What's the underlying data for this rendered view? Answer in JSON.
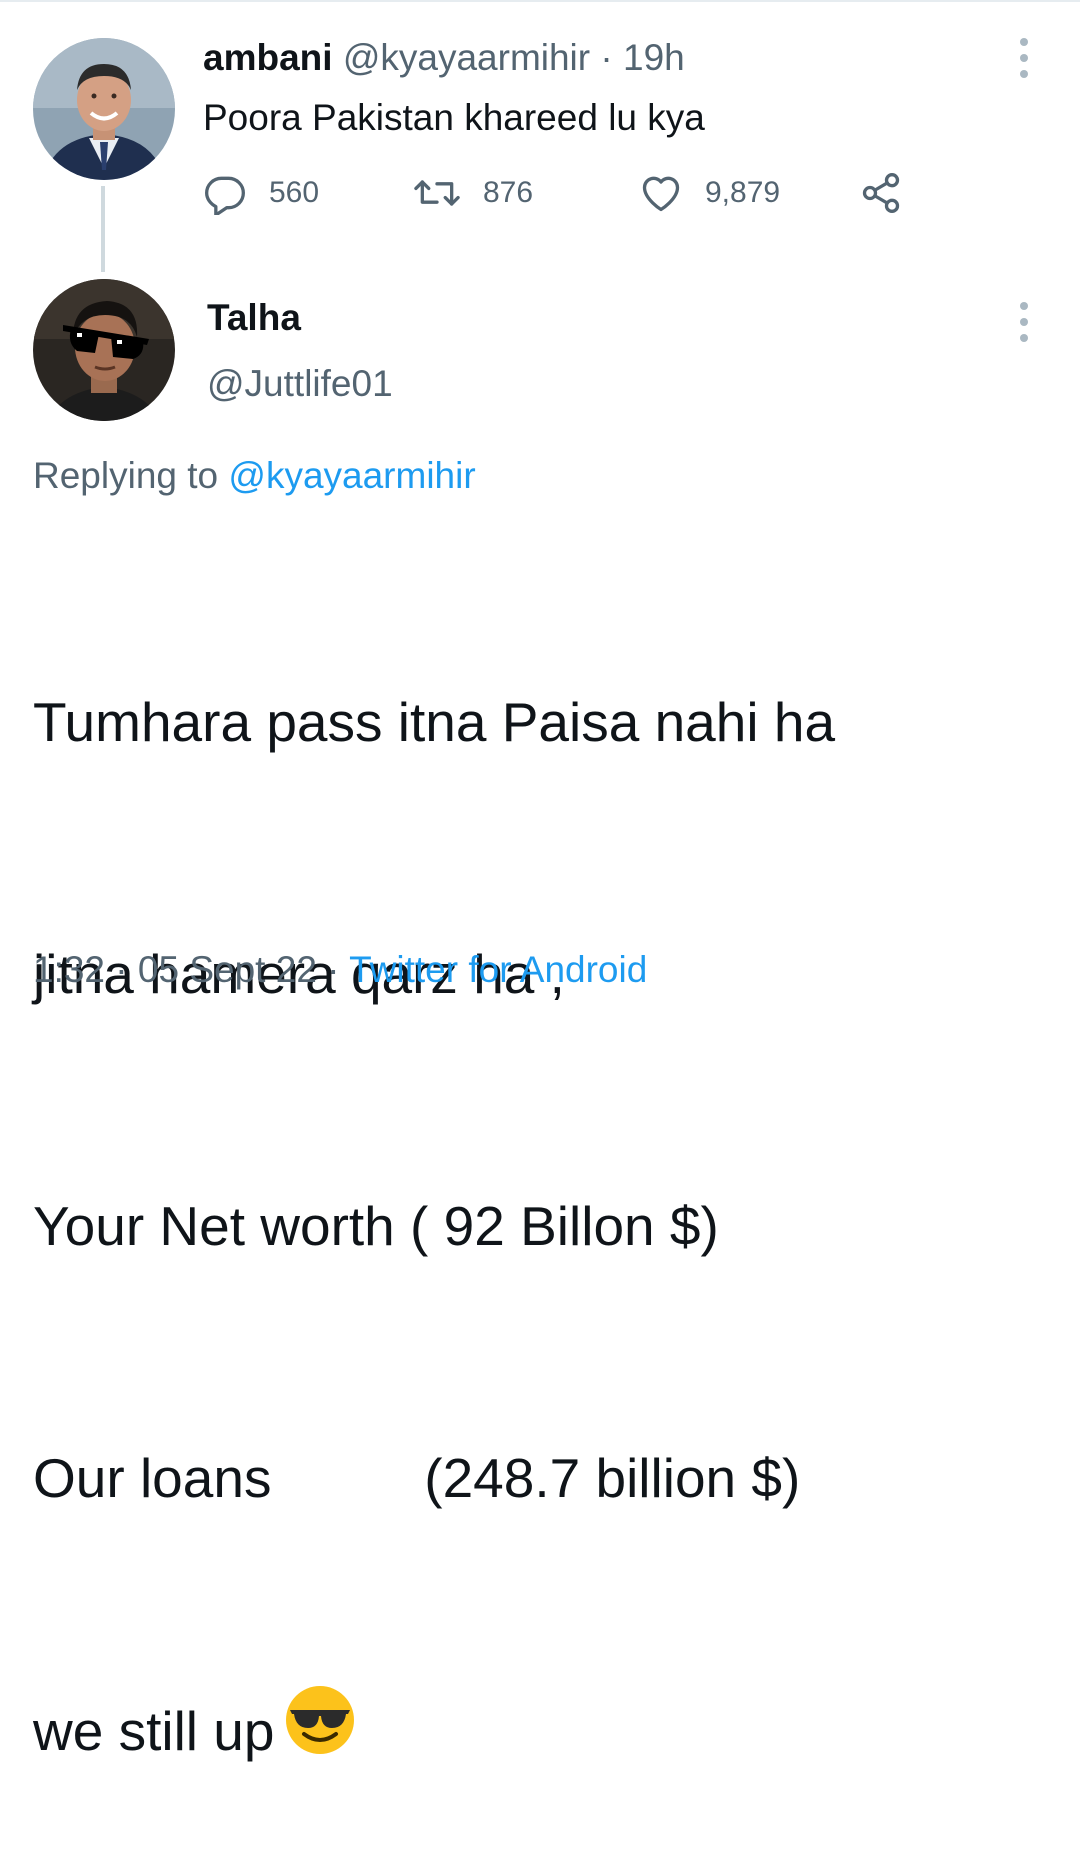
{
  "parent_tweet": {
    "name": "ambani",
    "handle": "@kyayaarmihir",
    "separator": "·",
    "time": "19h",
    "text": "Poora Pakistan khareed lu kya",
    "reply_count": "560",
    "retweet_count": "876",
    "like_count": "9,879",
    "icons": [
      "reply-icon",
      "retweet-icon",
      "like-icon",
      "share-icon",
      "more-options-icon"
    ]
  },
  "reply_tweet": {
    "name": "Talha",
    "handle": "@Juttlife01",
    "replying_prefix": "Replying to",
    "replying_to": "@kyayaarmihir",
    "lines": [
      "Tumhara pass itna Paisa nahi ha",
      "jitna hamera qarz ha ,",
      "Your Net worth ( 92 Billon $)",
      "Our loans          (248.7 billion $)",
      "we still up"
    ],
    "emoji": "smiling-face-with-sunglasses",
    "time": "1:32",
    "separator": "·",
    "date": "05 Sept 22",
    "source": "Twitter for Android"
  },
  "colors": {
    "text": "#0f1419",
    "secondary": "#536471",
    "link": "#1d9bf0",
    "thread_line": "#cfd9de"
  }
}
